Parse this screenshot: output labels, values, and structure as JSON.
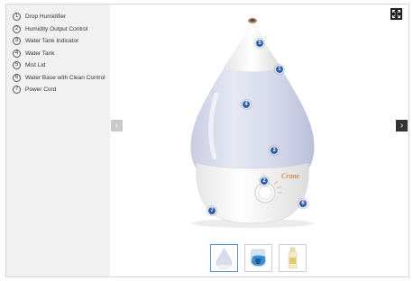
{
  "legend": {
    "items": [
      {
        "num": "1",
        "label": "Drop Humidifier"
      },
      {
        "num": "2",
        "label": "Humidity Output Control"
      },
      {
        "num": "3",
        "label": "Water Tank Indicator"
      },
      {
        "num": "4",
        "label": "Water Tank"
      },
      {
        "num": "5",
        "label": "Mist Lid"
      },
      {
        "num": "6",
        "label": "Water Base with Clean Control"
      },
      {
        "num": "7",
        "label": "Power Cord"
      }
    ]
  },
  "viewer": {
    "prev_icon": "chevron-left-icon",
    "next_icon": "chevron-right-icon",
    "fullscreen_icon": "fullscreen-icon",
    "prev_glyph": "‹",
    "next_glyph": "›"
  },
  "hotspots": [
    {
      "num": "5"
    },
    {
      "num": "1"
    },
    {
      "num": "4"
    },
    {
      "num": "3"
    },
    {
      "num": "2"
    },
    {
      "num": "6"
    },
    {
      "num": "7"
    }
  ],
  "product": {
    "brand": "Crane"
  },
  "thumbnails": [
    {
      "name": "humidifier-front",
      "selected": true
    },
    {
      "name": "humidifier-tank-blue",
      "selected": false
    },
    {
      "name": "cleaning-bottle",
      "selected": false
    }
  ],
  "colors": {
    "hotspot": "#2d5ba8",
    "sidebar_bg": "#f1f1f1",
    "brand_text": "#c8641e"
  }
}
